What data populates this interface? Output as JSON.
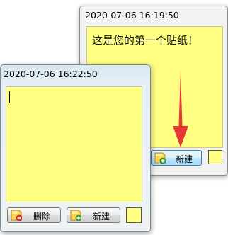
{
  "back_note": {
    "title": "2020-07-06 16:19:50",
    "content": "这是您的第一个贴纸！",
    "new_button_label": "新建",
    "note_color": "#ffff84"
  },
  "front_note": {
    "title": "2020-07-06 16:22:50",
    "content": "",
    "delete_button_label": "删除",
    "new_button_label": "新建",
    "note_color": "#ffff84"
  },
  "annotation": {
    "arrow_color": "#e53935"
  },
  "icons": {
    "new": "note-add-icon",
    "delete": "note-delete-icon"
  }
}
